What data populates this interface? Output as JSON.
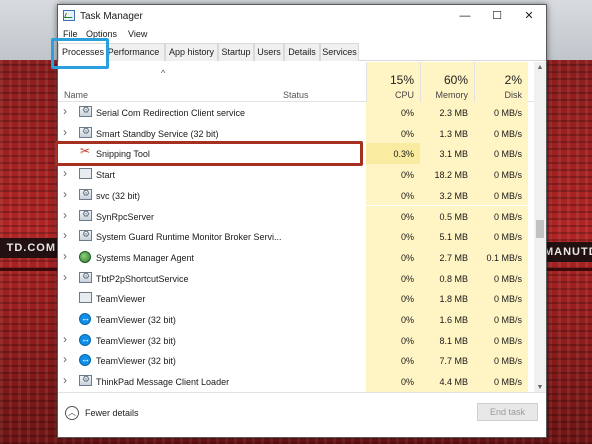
{
  "background": {
    "band_left": "TD.COM",
    "band_right": "MANUTD"
  },
  "window": {
    "title": "Task Manager",
    "icon": "task-manager-icon",
    "controls": {
      "minimize": "—",
      "maximize": "☐",
      "close": "✕"
    }
  },
  "menu": [
    "File",
    "Options",
    "View"
  ],
  "tabs": [
    "Processes",
    "Performance",
    "App history",
    "Startup",
    "Users",
    "Details",
    "Services"
  ],
  "active_tab": "Processes",
  "header": {
    "name": "Name",
    "status": "Status",
    "cpu": {
      "pct": "15%",
      "label": "CPU"
    },
    "memory": {
      "pct": "60%",
      "label": "Memory"
    },
    "disk": {
      "pct": "2%",
      "label": "Disk"
    },
    "sort_indicator": "^"
  },
  "rows": [
    {
      "name": "Serial Com Redirection Client service",
      "icon": "service-icon",
      "expandable": true,
      "cpu": "0%",
      "memory": "2.3 MB",
      "disk": "0 MB/s"
    },
    {
      "name": "Smart Standby Service (32 bit)",
      "icon": "service-icon",
      "expandable": true,
      "cpu": "0%",
      "memory": "1.3 MB",
      "disk": "0 MB/s"
    },
    {
      "name": "Snipping Tool",
      "icon": "scissors-icon",
      "expandable": false,
      "cpu": "0.3%",
      "memory": "3.1 MB",
      "disk": "0 MB/s",
      "hot": true
    },
    {
      "name": "Start",
      "icon": "app-icon",
      "expandable": true,
      "cpu": "0%",
      "memory": "18.2 MB",
      "disk": "0 MB/s"
    },
    {
      "name": "svc (32 bit)",
      "icon": "service-icon",
      "expandable": true,
      "cpu": "0%",
      "memory": "3.2 MB",
      "disk": "0 MB/s"
    },
    {
      "name": "SynRpcServer",
      "icon": "service-icon",
      "expandable": true,
      "cpu": "0%",
      "memory": "0.5 MB",
      "disk": "0 MB/s"
    },
    {
      "name": "System Guard Runtime Monitor Broker Servi...",
      "icon": "service-icon",
      "expandable": true,
      "cpu": "0%",
      "memory": "5.1 MB",
      "disk": "0 MB/s"
    },
    {
      "name": "Systems Manager Agent",
      "icon": "systems-manager-icon",
      "expandable": true,
      "cpu": "0%",
      "memory": "2.7 MB",
      "disk": "0.1 MB/s",
      "highlighted": true
    },
    {
      "name": "TbtP2pShortcutService",
      "icon": "service-icon",
      "expandable": true,
      "cpu": "0%",
      "memory": "0.8 MB",
      "disk": "0 MB/s"
    },
    {
      "name": "TeamViewer",
      "icon": "app-icon",
      "expandable": false,
      "cpu": "0%",
      "memory": "1.8 MB",
      "disk": "0 MB/s"
    },
    {
      "name": "TeamViewer (32 bit)",
      "icon": "teamviewer-icon",
      "expandable": false,
      "cpu": "0%",
      "memory": "1.6 MB",
      "disk": "0 MB/s"
    },
    {
      "name": "TeamViewer (32 bit)",
      "icon": "teamviewer-icon",
      "expandable": true,
      "cpu": "0%",
      "memory": "8.1 MB",
      "disk": "0 MB/s"
    },
    {
      "name": "TeamViewer (32 bit)",
      "icon": "teamviewer-icon",
      "expandable": true,
      "cpu": "0%",
      "memory": "7.7 MB",
      "disk": "0 MB/s"
    },
    {
      "name": "ThinkPad Message Client Loader",
      "icon": "service-icon",
      "expandable": true,
      "cpu": "0%",
      "memory": "4.4 MB",
      "disk": "0 MB/s"
    }
  ],
  "footer": {
    "fewer_details": "Fewer details",
    "end_task": "End task"
  },
  "colors": {
    "tab_highlight": "#2aa1de",
    "row_highlight": "#a6301f",
    "heat_cell": "#fff4c4"
  }
}
